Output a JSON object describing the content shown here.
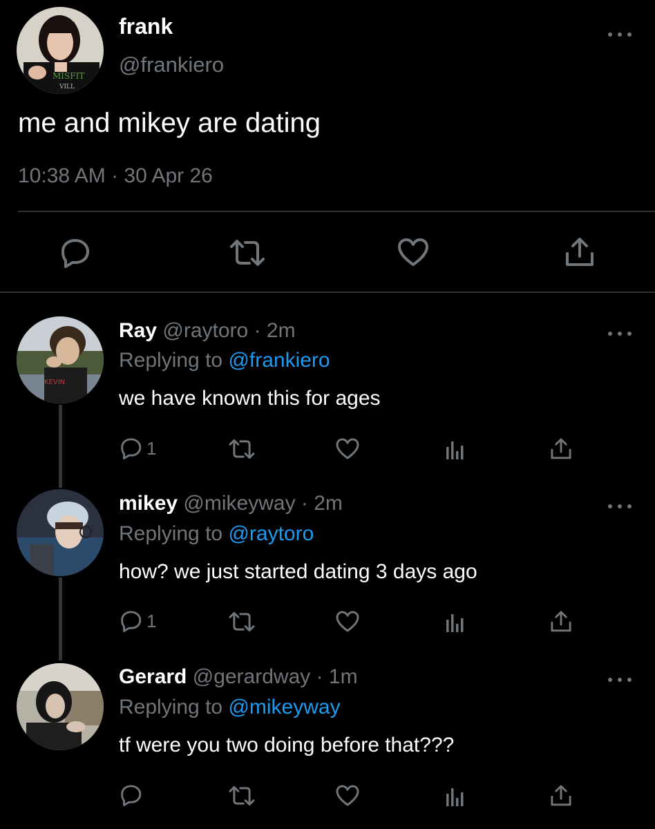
{
  "main_tweet": {
    "name": "frank",
    "handle": "@frankiero",
    "text": "me and mikey are dating",
    "timestamp": "10:38 AM · 30 Apr 26",
    "actions": [
      "reply-icon",
      "retweet-icon",
      "like-icon",
      "share-icon"
    ]
  },
  "replies": [
    {
      "name": "Ray",
      "handle": "@raytoro",
      "time": "· 2m",
      "replying_prefix": "Replying to",
      "replying_to": "@frankiero",
      "text": "we have known this for ages",
      "reply_count": "1"
    },
    {
      "name": "mikey",
      "handle": "@mikeyway",
      "time": "· 2m",
      "replying_prefix": "Replying to",
      "replying_to": "@raytoro",
      "text": "how? we just started dating 3 days ago",
      "reply_count": "1"
    },
    {
      "name": "Gerard",
      "handle": "@gerardway",
      "time": "· 1m",
      "replying_prefix": "Replying to",
      "replying_to": "@mikeyway",
      "text": "tf were you two doing before that???",
      "reply_count": ""
    }
  ],
  "colors": {
    "background": "#000000",
    "text": "#e7e9ea",
    "secondary": "#71767b",
    "link": "#1d9bf0",
    "divider": "#2f3336"
  }
}
